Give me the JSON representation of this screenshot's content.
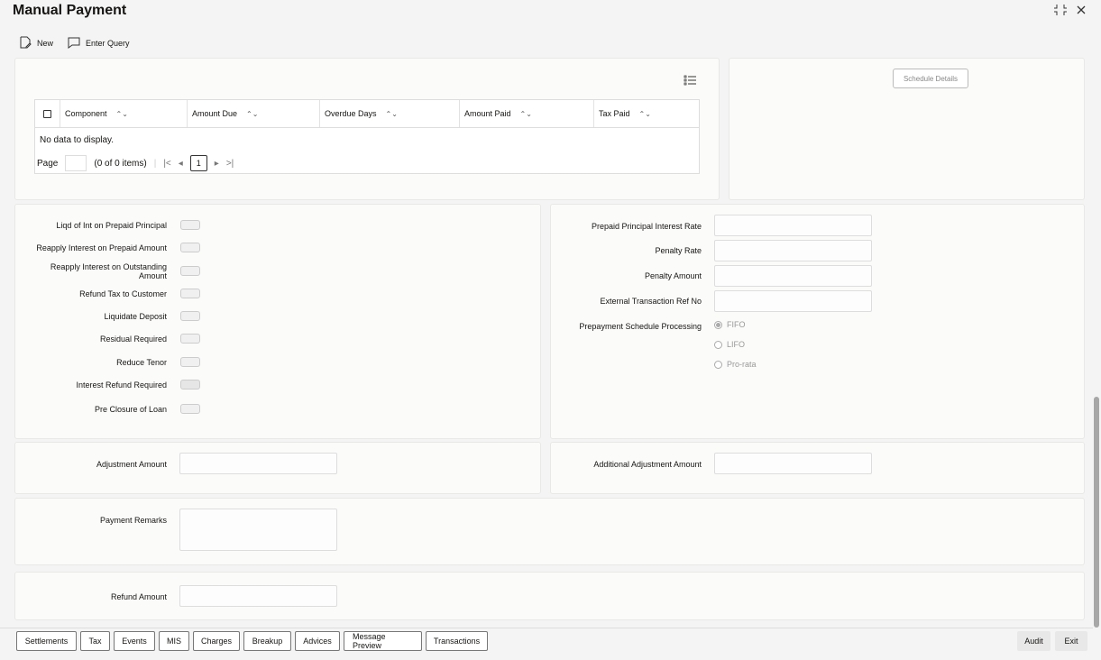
{
  "window": {
    "title": "Manual Payment"
  },
  "toolbar": {
    "new_label": "New",
    "enter_query_label": "Enter Query"
  },
  "grid": {
    "columns": [
      "Component",
      "Amount Due",
      "Overdue Days",
      "Amount Paid",
      "Tax Paid"
    ],
    "empty_text": "No data to display.",
    "pager": {
      "page_label": "Page",
      "items_text": "(0 of 0 items)",
      "current_page": "1"
    }
  },
  "schedule_details_label": "Schedule Details",
  "left_options": [
    "Liqd of Int on Prepaid Principal",
    "Reapply Interest on Prepaid Amount",
    "Reapply Interest on Outstanding Amount",
    "Refund Tax to Customer",
    "Liquidate Deposit",
    "Residual Required",
    "Reduce Tenor",
    "Interest Refund Required",
    "Pre Closure of Loan"
  ],
  "right_fields": {
    "prepaid_principal_interest_rate": "Prepaid Principal Interest Rate",
    "penalty_rate": "Penalty Rate",
    "penalty_amount": "Penalty Amount",
    "external_txn_ref": "External Transaction Ref No",
    "prepayment_schedule_processing": "Prepayment Schedule Processing",
    "radio_options": [
      "FIFO",
      "LIFO",
      "Pro-rata"
    ],
    "selected": "FIFO"
  },
  "adjustment_amount_label": "Adjustment Amount",
  "additional_adjustment_amount_label": "Additional Adjustment Amount",
  "payment_remarks_label": "Payment Remarks",
  "refund_amount_label": "Refund Amount",
  "footer_buttons": [
    "Settlements",
    "Tax",
    "Events",
    "MIS",
    "Charges",
    "Breakup",
    "Advices",
    "Message Preview",
    "Transactions"
  ],
  "footer_right": {
    "audit": "Audit",
    "exit": "Exit"
  }
}
